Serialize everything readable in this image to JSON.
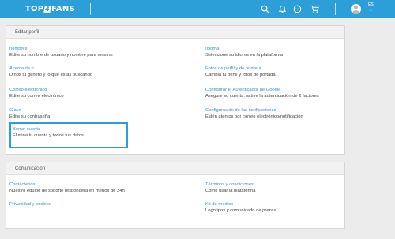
{
  "brand": {
    "part1": "TOP",
    "part2": "4",
    "part3": "FANS"
  },
  "header": {
    "language": "ES"
  },
  "sections": [
    {
      "title": "Editar perfil",
      "items": [
        {
          "title": "nombres",
          "desc": "Edite su nombre de usuario y nombre para mostrar"
        },
        {
          "title": "Idioma",
          "desc": "Seleccione su idioma en la plataforma"
        },
        {
          "title": "Acerca de ti",
          "desc": "Dinos tu género y lo que estás buscando"
        },
        {
          "title": "Fotos de perfil y de portada",
          "desc": "Cambia tu perfil y fotos de portada"
        },
        {
          "title": "Correo electrónico",
          "desc": "Edite su correo electrónico"
        },
        {
          "title": "Configurar el Autenticador de Google",
          "desc": "Asegure su cuenta: active la autenticación de 2 factores"
        },
        {
          "title": "Clave",
          "desc": "Edite su contraseña"
        },
        {
          "title": "Configuración de las notificaciones",
          "desc": "Estén atentos por correo electrónico/notificación"
        },
        {
          "title": "Borrar cuenta",
          "desc": "Elimina tu cuenta y todos tus datos"
        }
      ]
    },
    {
      "title": "Comunicación",
      "items": [
        {
          "title": "Contáctenos",
          "desc": "Nuestro equipo de soporte responderá en menos de 24h"
        },
        {
          "title": "Términos y condiciones",
          "desc": "Como usar la plataforma"
        },
        {
          "title": "Privacidad y cookies",
          "desc": ""
        },
        {
          "title": "Kit de medios",
          "desc": "Logotipos y comunicado de prensa"
        }
      ]
    }
  ],
  "icons": [
    "search-icon",
    "bell-icon",
    "chat-icon",
    "cart-icon",
    "avatar",
    "chevron-down-icon"
  ]
}
